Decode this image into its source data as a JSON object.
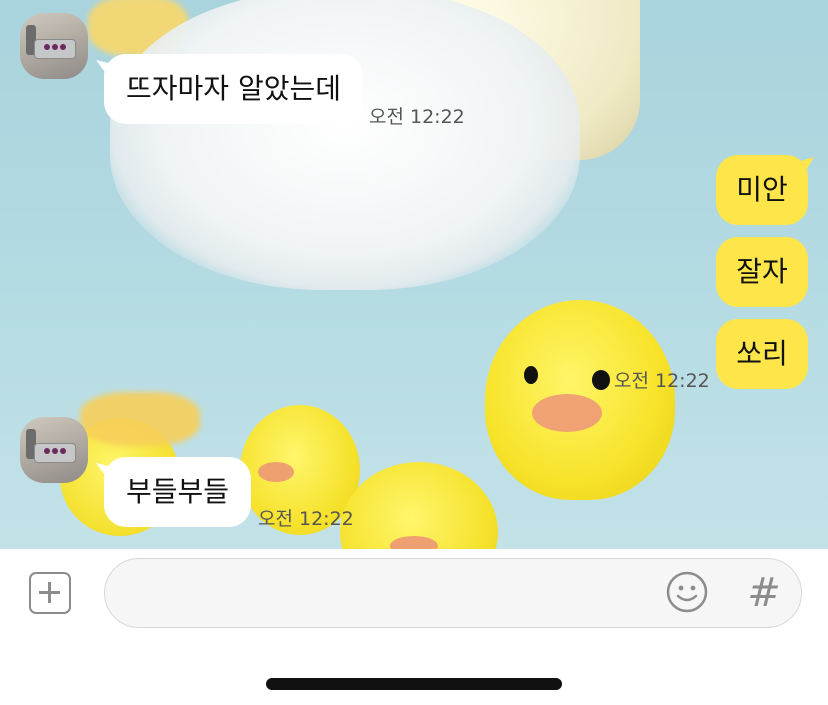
{
  "messages": {
    "m1": {
      "text": "뜨자마자 알았는데",
      "time": "오전 12:22"
    },
    "m2": {
      "text": "미안"
    },
    "m3": {
      "text": "잘자"
    },
    "m4": {
      "text": "쏘리",
      "time": "오전 12:22"
    },
    "m5": {
      "text": "부들부들",
      "time": "오전 12:22"
    }
  },
  "input_bar": {
    "placeholder": "",
    "plus_icon": "plus-square-icon",
    "emoji_icon": "smiley-icon",
    "hash_label": "#"
  },
  "colors": {
    "outgoing_bubble": "#fde54a",
    "incoming_bubble": "#ffffff"
  }
}
